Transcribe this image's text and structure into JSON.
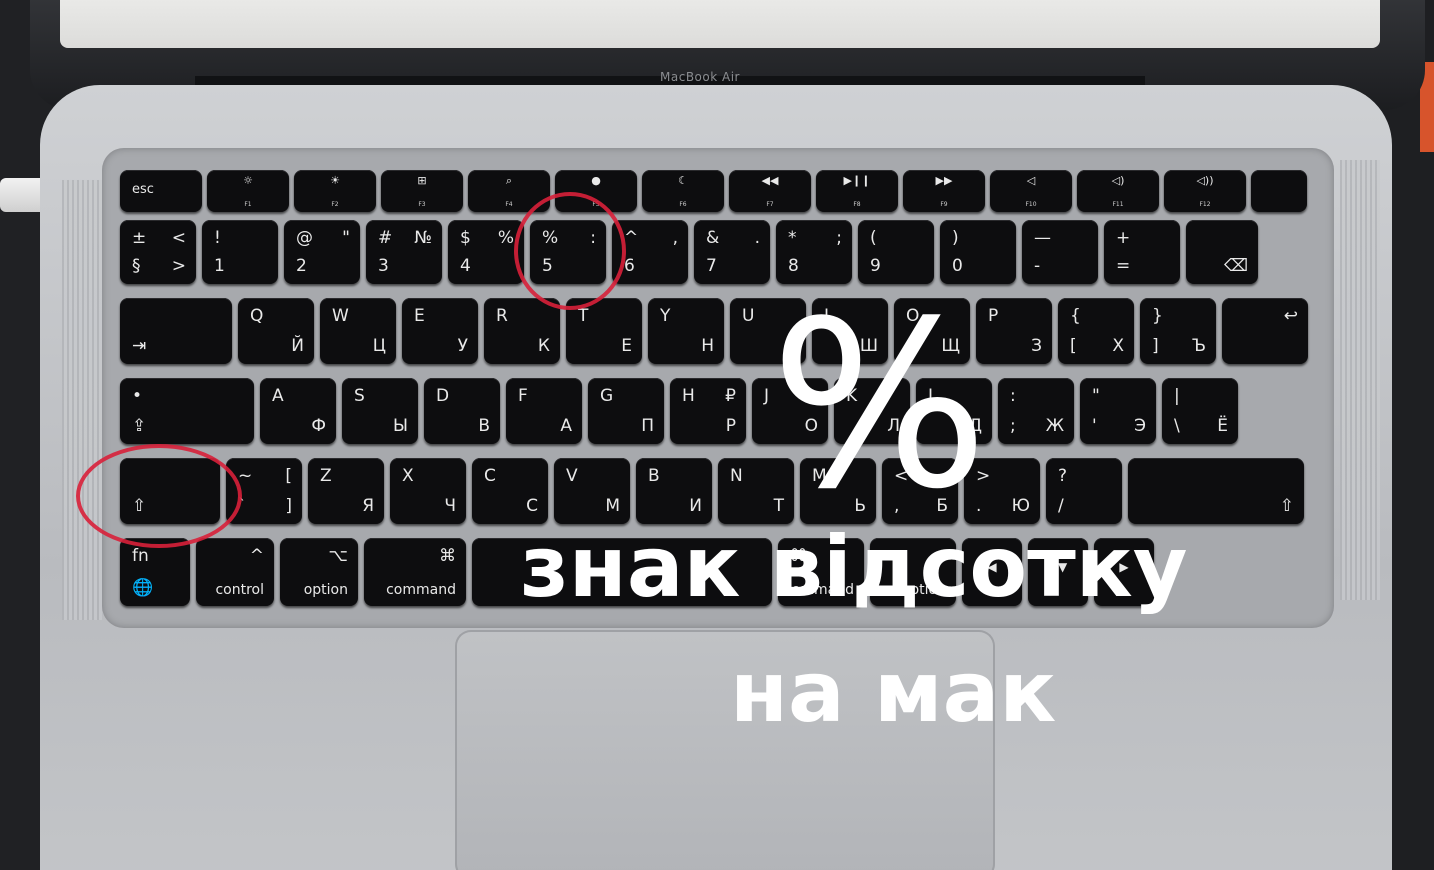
{
  "brand": "MacBook Air",
  "overlay": {
    "percent_symbol": "%",
    "title_line1": "знак  відсотку",
    "title_line2": "на мак"
  },
  "colors": {
    "highlight": "#d8203a",
    "keycap": "#0d0d0f",
    "legend": "#e9e9e9"
  },
  "keyboard": {
    "fn_row": [
      {
        "label": "esc"
      },
      {
        "label": "F1",
        "icon": "☼"
      },
      {
        "label": "F2",
        "icon": "☀"
      },
      {
        "label": "F3",
        "icon": "⊞"
      },
      {
        "label": "F4",
        "icon": "⌕"
      },
      {
        "label": "F5",
        "icon": "●"
      },
      {
        "label": "F6",
        "icon": "☾"
      },
      {
        "label": "F7",
        "icon": "◀◀"
      },
      {
        "label": "F8",
        "icon": "▶❙❙"
      },
      {
        "label": "F9",
        "icon": "▶▶"
      },
      {
        "label": "F10",
        "icon": "◁"
      },
      {
        "label": "F11",
        "icon": "◁)"
      },
      {
        "label": "F12",
        "icon": "◁))"
      },
      {
        "label": ""
      }
    ],
    "number_row": [
      {
        "tl": "±",
        "bl": "§",
        "tr": "<",
        "br": ">"
      },
      {
        "tl": "!",
        "bl": "1"
      },
      {
        "tl": "@",
        "bl": "2",
        "tr": "\""
      },
      {
        "tl": "#",
        "bl": "3",
        "tr": "№"
      },
      {
        "tl": "$",
        "bl": "4",
        "tr": "%"
      },
      {
        "tl": "%",
        "bl": "5",
        "tr": ":"
      },
      {
        "tl": "^",
        "bl": "6",
        "tr": ","
      },
      {
        "tl": "&",
        "bl": "7",
        "tr": "."
      },
      {
        "tl": "*",
        "bl": "8",
        "tr": ";"
      },
      {
        "tl": "(",
        "bl": "9"
      },
      {
        "tl": ")",
        "bl": "0"
      },
      {
        "tl": "—",
        "bl": "-"
      },
      {
        "tl": "+",
        "bl": "="
      },
      {
        "br": "⌫"
      }
    ],
    "qwerty_row": [
      {
        "bl": "⇥"
      },
      {
        "tl": "Q",
        "br": "Й"
      },
      {
        "tl": "W",
        "br": "Ц"
      },
      {
        "tl": "E",
        "br": "У"
      },
      {
        "tl": "R",
        "br": "К"
      },
      {
        "tl": "T",
        "br": "Е"
      },
      {
        "tl": "Y",
        "br": "Н"
      },
      {
        "tl": "U",
        "br": "Г"
      },
      {
        "tl": "I",
        "br": "Ш"
      },
      {
        "tl": "O",
        "br": "Щ"
      },
      {
        "tl": "P",
        "br": "З"
      },
      {
        "tl": "{",
        "bl": "[",
        "br": "Х"
      },
      {
        "tl": "}",
        "bl": "]",
        "br": "Ъ"
      },
      {
        "tr": "↩"
      }
    ],
    "home_row": [
      {
        "tl": "•",
        "bl": "⇪"
      },
      {
        "tl": "A",
        "br": "Ф"
      },
      {
        "tl": "S",
        "br": "Ы"
      },
      {
        "tl": "D",
        "br": "В"
      },
      {
        "tl": "F",
        "br": "А"
      },
      {
        "tl": "G",
        "br": "П"
      },
      {
        "tl": "H",
        "tr": "₽",
        "br": "Р"
      },
      {
        "tl": "J",
        "br": "О"
      },
      {
        "tl": "K",
        "br": "Л"
      },
      {
        "tl": "L",
        "br": "Д"
      },
      {
        "tl": ":",
        "bl": ";",
        "br": "Ж"
      },
      {
        "tl": "\"",
        "bl": "'",
        "br": "Э"
      },
      {
        "tl": "|",
        "bl": "\\",
        "br": "Ё"
      }
    ],
    "shift_row": [
      {
        "bl": "⇧"
      },
      {
        "tl": "~",
        "bl": "`",
        "tr": "[",
        "br": "]"
      },
      {
        "tl": "Z",
        "br": "Я"
      },
      {
        "tl": "X",
        "br": "Ч"
      },
      {
        "tl": "C",
        "br": "С"
      },
      {
        "tl": "V",
        "br": "М"
      },
      {
        "tl": "B",
        "br": "И"
      },
      {
        "tl": "N",
        "br": "Т"
      },
      {
        "tl": "M",
        "br": "Ь"
      },
      {
        "tl": "<",
        "bl": ",",
        "br": "Б"
      },
      {
        "tl": ">",
        "bl": ".",
        "br": "Ю"
      },
      {
        "tl": "?",
        "bl": "/"
      },
      {
        "br": "⇧"
      }
    ],
    "bottom_row": [
      {
        "tl": "fn",
        "bl": "🌐"
      },
      {
        "tr": "^",
        "br": "control"
      },
      {
        "tr": "⌥",
        "br": "option"
      },
      {
        "tr": "⌘",
        "br": "command"
      },
      {
        "label": ""
      },
      {
        "tl": "⌘",
        "br": "command"
      },
      {
        "tl": "⌥",
        "br": "option"
      },
      {
        "label": "◀"
      },
      {
        "label": "▲▼"
      },
      {
        "label": "▶"
      }
    ]
  }
}
